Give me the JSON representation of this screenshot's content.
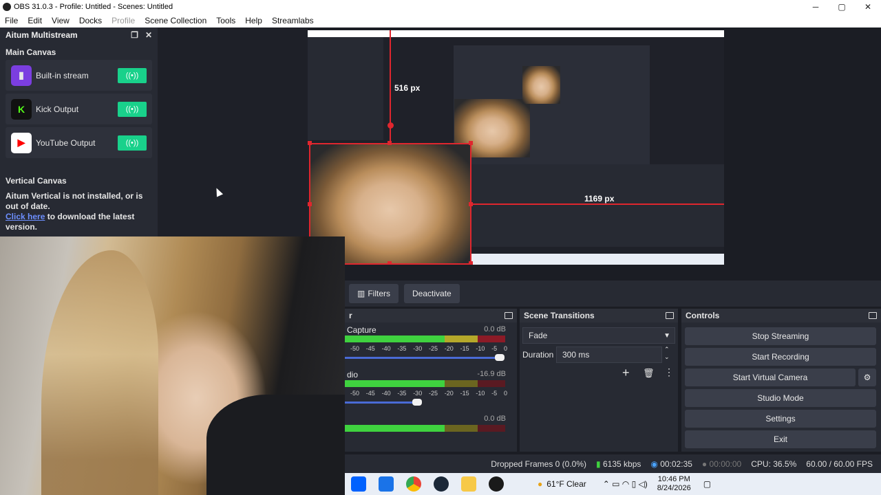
{
  "window": {
    "title": "OBS 31.0.3 - Profile: Untitled - Scenes: Untitled",
    "controls": [
      "─",
      "▢",
      "✕"
    ]
  },
  "menu": [
    "File",
    "Edit",
    "View",
    "Docks",
    "Profile",
    "Scene Collection",
    "Tools",
    "Help",
    "Streamlabs"
  ],
  "dock": {
    "title": "Aitum Multistream",
    "main_canvas": "Main Canvas",
    "outputs": [
      {
        "label": "Built-in stream",
        "icon": "twitch-icon",
        "color": "#7b3ee0"
      },
      {
        "label": "Kick Output",
        "icon": "kick-icon",
        "color": "#53fc18"
      },
      {
        "label": "YouTube Output",
        "icon": "youtube-icon",
        "color": "#ff0000"
      }
    ],
    "toggle_glyph": "((•))",
    "vertical_canvas": "Vertical Canvas",
    "vertical_msg": "Aitum Vertical is not installed, or is out of date.",
    "click_here": "Click here",
    "download_msg": " to download the latest version."
  },
  "preview": {
    "measure_top": "516 px",
    "measure_right": "1169 px"
  },
  "sources_bar": {
    "filters": "Filters",
    "deactivate": "Deactivate"
  },
  "mixer": {
    "title": "r",
    "tracks": [
      {
        "name": "Capture",
        "db": "0.0 dB",
        "level": 1.0
      },
      {
        "name": "dio",
        "db": "-16.9 dB",
        "level": 0.6
      },
      {
        "name": "",
        "db": "0.0 dB",
        "level": null
      }
    ],
    "scale": [
      "-50",
      "-45",
      "-40",
      "-35",
      "-30",
      "-25",
      "-20",
      "-15",
      "-10",
      "-5",
      "0"
    ]
  },
  "transitions": {
    "title": "Scene Transitions",
    "selected": "Fade",
    "duration_label": "Duration",
    "duration_value": "300 ms"
  },
  "controls": {
    "title": "Controls",
    "buttons": [
      "Stop Streaming",
      "Start Recording",
      "Start Virtual Camera",
      "Studio Mode",
      "Settings",
      "Exit"
    ]
  },
  "status": {
    "dropped": "Dropped Frames 0 (0.0%)",
    "bitrate": "6135 kbps",
    "stream_time": "00:02:35",
    "rec_time": "00:00:00",
    "cpu": "CPU: 36.5%",
    "fps": "60.00 / 60.00 FPS"
  },
  "taskbar": {
    "weather": "61°F  Clear",
    "time": "10:46 PM",
    "date": "8/24/2026"
  }
}
